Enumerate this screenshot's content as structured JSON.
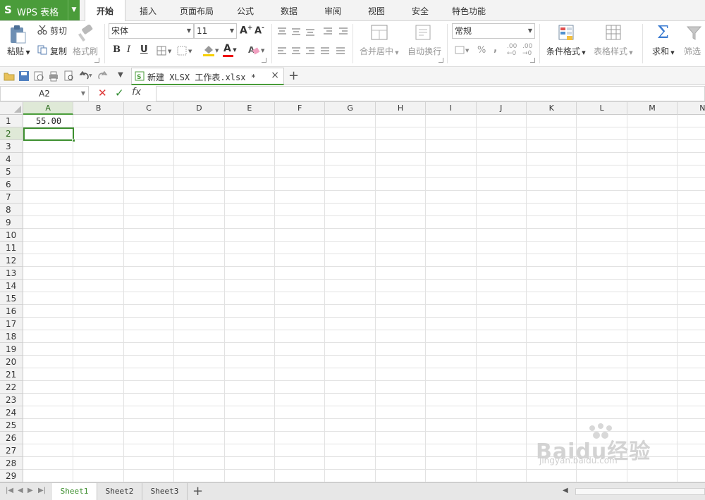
{
  "app": {
    "title": "WPS 表格",
    "logo_letter": "S"
  },
  "menu_tabs": [
    {
      "label": "开始",
      "active": true
    },
    {
      "label": "插入"
    },
    {
      "label": "页面布局"
    },
    {
      "label": "公式"
    },
    {
      "label": "数据"
    },
    {
      "label": "审阅"
    },
    {
      "label": "视图"
    },
    {
      "label": "安全"
    },
    {
      "label": "特色功能"
    }
  ],
  "ribbon": {
    "paste": "粘贴",
    "cut": "剪切",
    "copy": "复制",
    "format_painter": "格式刷",
    "font_name": "宋体",
    "font_size": "11",
    "bold": "B",
    "italic": "I",
    "underline": "U",
    "font_color_letter": "A",
    "merge_center": "合并居中",
    "wrap_text": "自动换行",
    "number_format": "常规",
    "percent": "%",
    "comma": ",",
    "dec_increase": ".00",
    "dec_decrease": ".00",
    "conditional_format": "条件格式",
    "table_style": "表格样式",
    "sum": "求和",
    "filter": "筛选"
  },
  "doc_tab": {
    "name": "新建 XLSX 工作表.xlsx *"
  },
  "formula_bar": {
    "name_box": "A2",
    "cancel": "✕",
    "confirm": "✓",
    "fx": "fx",
    "formula": ""
  },
  "columns": [
    "A",
    "B",
    "C",
    "D",
    "E",
    "F",
    "G",
    "H",
    "I",
    "J",
    "K",
    "L",
    "M",
    "N"
  ],
  "rows": [
    "1",
    "2",
    "3",
    "4",
    "5",
    "6",
    "7",
    "8",
    "9",
    "10",
    "11",
    "12",
    "13",
    "14",
    "15",
    "16",
    "17",
    "18",
    "19",
    "20",
    "21",
    "22",
    "23",
    "24",
    "25",
    "26",
    "27",
    "28",
    "29"
  ],
  "cells": {
    "A1": "55.00"
  },
  "selected_cell": "A2",
  "sheets": [
    {
      "label": "Sheet1",
      "active": true
    },
    {
      "label": "Sheet2"
    },
    {
      "label": "Sheet3"
    }
  ],
  "watermark": {
    "brand": "Baidu经验",
    "url": "jingyan.baidu.com"
  },
  "colors": {
    "accent": "#4a9c3a",
    "header_bg": "#f2f2f2",
    "grid": "#e2e2e2"
  }
}
